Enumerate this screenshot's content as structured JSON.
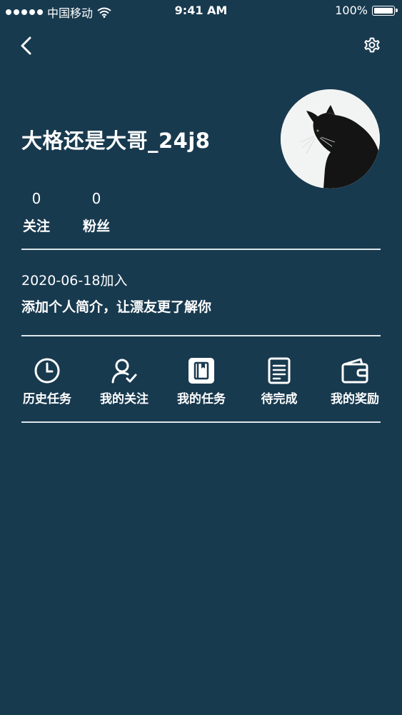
{
  "status_bar": {
    "carrier": "中国移动",
    "time": "9:41 AM",
    "battery": "100%"
  },
  "profile": {
    "username": "大格还是大哥_24j8",
    "stats": [
      {
        "value": "0",
        "label": "关注"
      },
      {
        "value": "0",
        "label": "粉丝"
      }
    ],
    "join_date": "2020-06-18加入",
    "bio": "添加个人简介，让漂友更了解你"
  },
  "menu": [
    {
      "label": "历史任务",
      "icon": "clock-icon"
    },
    {
      "label": "我的关注",
      "icon": "user-check-icon"
    },
    {
      "label": "我的任务",
      "icon": "book-icon"
    },
    {
      "label": "待完成",
      "icon": "document-icon"
    },
    {
      "label": "我的奖励",
      "icon": "wallet-icon"
    }
  ],
  "colors": {
    "background": "#183a4f",
    "text": "#ffffff",
    "divider": "#dfe6ea"
  }
}
